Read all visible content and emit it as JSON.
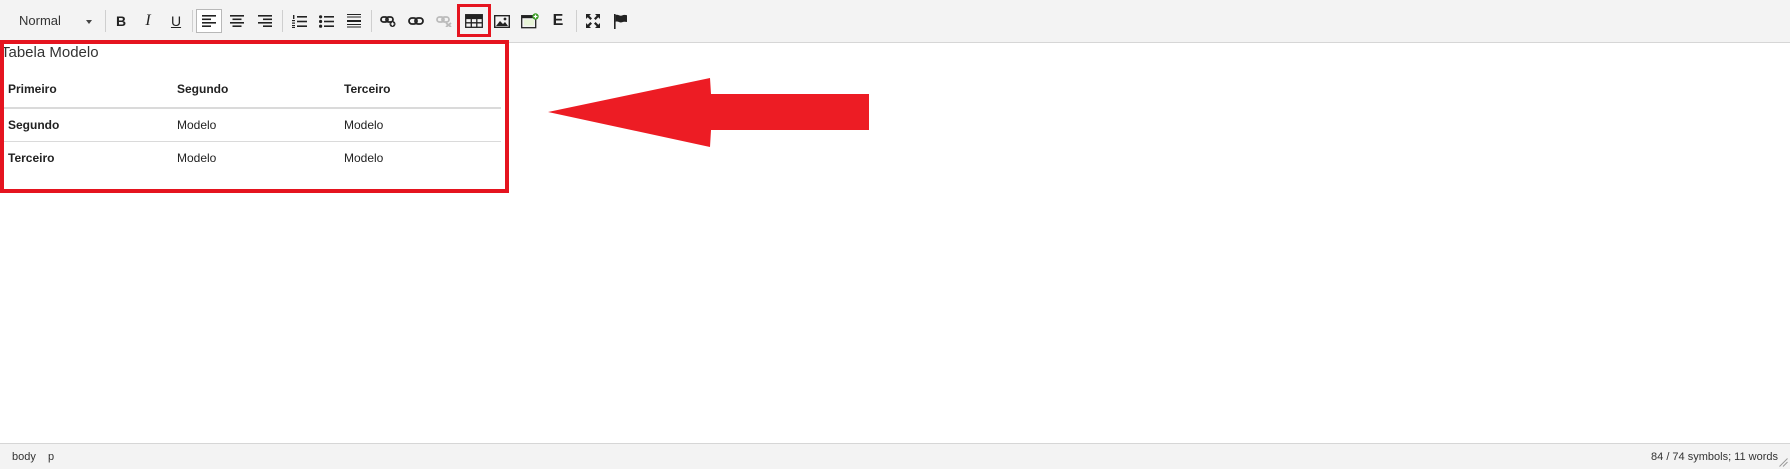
{
  "toolbar": {
    "format_select": "Normal",
    "icons": [
      "bold-icon",
      "italic-icon",
      "underline-icon",
      "align-left-icon",
      "align-center-icon",
      "align-right-icon",
      "ordered-list-icon",
      "unordered-list-icon",
      "horizontal-rule-icon",
      "insert-link-icon",
      "edit-link-icon",
      "unlink-icon",
      "table-icon",
      "image-icon",
      "media-icon",
      "e-icon",
      "fullscreen-icon",
      "flag-icon"
    ],
    "bold": "B",
    "italic": "I",
    "underline": "U",
    "e_label": "E",
    "highlight_color": "#e5141f"
  },
  "editor": {
    "title": "Tabela Modelo",
    "table": {
      "header": [
        "Primeiro",
        "Segundo",
        "Terceiro"
      ],
      "rows": [
        [
          "Segundo",
          "Modelo",
          "Modelo"
        ],
        [
          "Terceiro",
          "Modelo",
          "Modelo"
        ]
      ]
    }
  },
  "statusbar": {
    "path": [
      "body",
      "p"
    ],
    "word_count": "84 / 74 symbols; 11 words"
  }
}
